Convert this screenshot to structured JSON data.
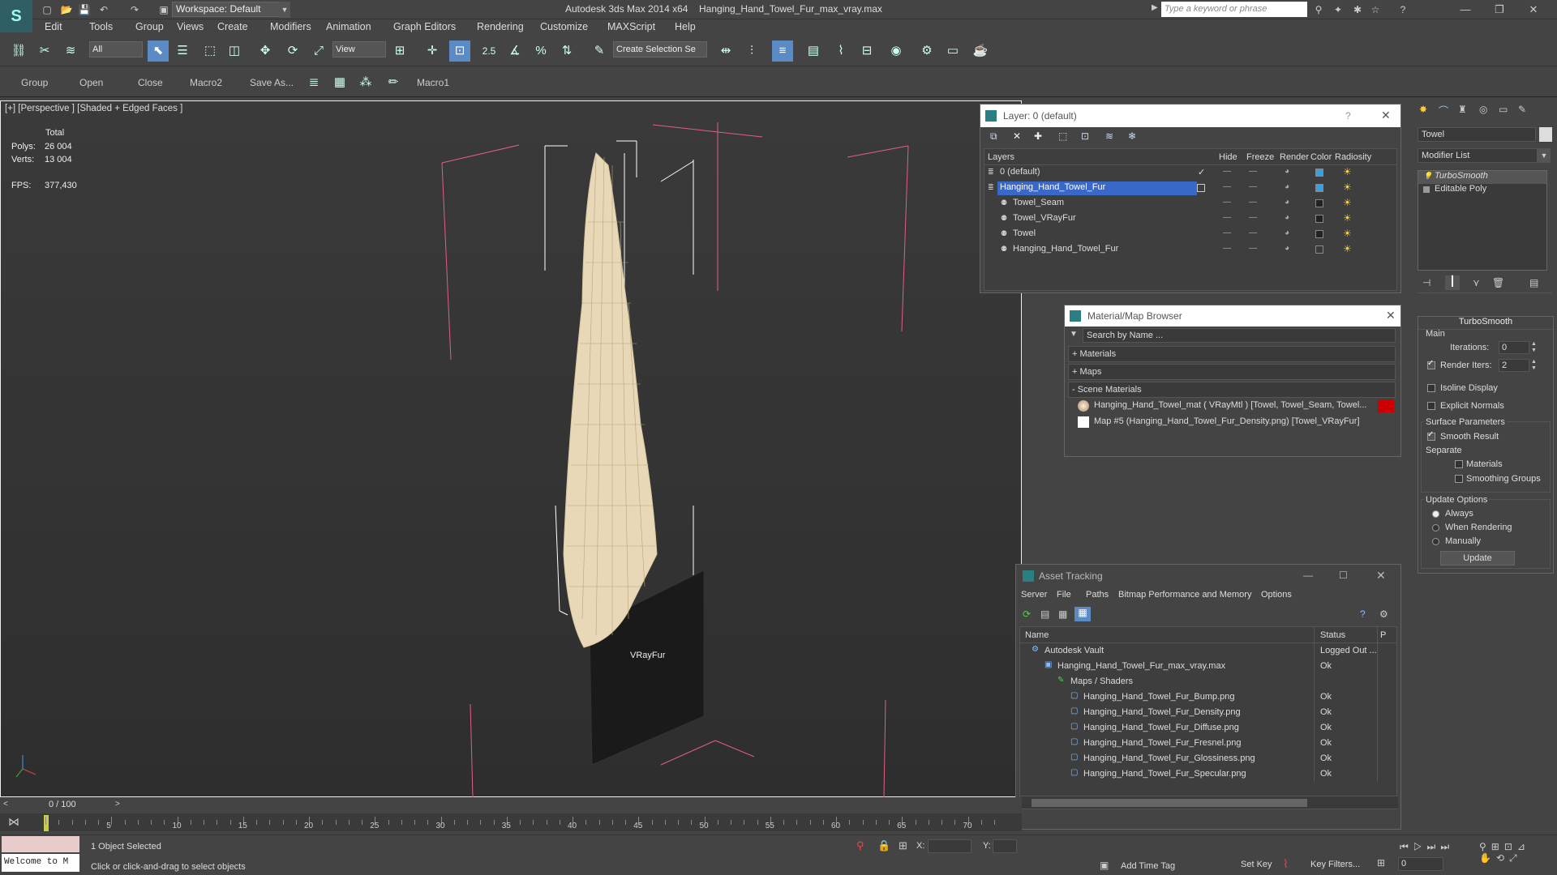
{
  "app": {
    "title": "Autodesk 3ds Max  2014 x64",
    "file": "Hanging_Hand_Towel_Fur_max_vray.max",
    "workspace": "Workspace: Default",
    "search_placeholder": "Type a keyword or phrase"
  },
  "menu": [
    "Edit",
    "Tools",
    "Group",
    "Views",
    "Create",
    "Modifiers",
    "Animation",
    "Graph Editors",
    "Rendering",
    "Customize",
    "MAXScript",
    "Help"
  ],
  "toolbar": {
    "selection_filter": "All",
    "ref_coord": "View",
    "snap_value": "2.5",
    "named_selection": "Create Selection Se"
  },
  "toolbar2": [
    "Group",
    "Open",
    "Close",
    "Macro2",
    "Save As...",
    "Macro1"
  ],
  "viewport": {
    "label": "[+] [Perspective ] [Shaded + Edged Faces ]",
    "stats_header": "Total",
    "polys_label": "Polys:",
    "polys": "26 004",
    "verts_label": "Verts:",
    "verts": "13 004",
    "fps_label": "FPS:",
    "fps": "377,430",
    "object_label": "VRayFur"
  },
  "layer_panel": {
    "title": "Layer: 0 (default)",
    "help": "?",
    "columns": [
      "Layers",
      "Hide",
      "Freeze",
      "Render",
      "Color",
      "Radiosity"
    ],
    "rows": [
      {
        "name": "0 (default)",
        "level": 0,
        "color": "#3aa0e0"
      },
      {
        "name": "Hanging_Hand_Towel_Fur",
        "level": 0,
        "color": "#3aa0e0"
      },
      {
        "name": "Towel_Seam",
        "level": 1,
        "color": "#222222"
      },
      {
        "name": "Towel_VRayFur",
        "level": 1,
        "color": "#222222"
      },
      {
        "name": "Towel",
        "level": 1,
        "color": "#222222"
      },
      {
        "name": "Hanging_Hand_Towel_Fur",
        "level": 1,
        "color": "#3a3a3a"
      }
    ]
  },
  "material_browser": {
    "title": "Material/Map Browser",
    "search_placeholder": "Search by Name ...",
    "sections": [
      "+ Materials",
      "+ Maps",
      "- Scene Materials"
    ],
    "items": [
      "Hanging_Hand_Towel_mat  ( VRayMtl )  [Towel, Towel_Seam, Towel...",
      "Map #5 (Hanging_Hand_Towel_Fur_Density.png) [Towel_VRayFur]"
    ]
  },
  "asset_tracking": {
    "title": "Asset Tracking",
    "menu": [
      "Server",
      "File",
      "Paths",
      "Bitmap Performance and Memory",
      "Options"
    ],
    "columns": [
      "Name",
      "Status",
      "P"
    ],
    "rows": [
      {
        "name": "Autodesk Vault",
        "status": "Logged Out ...",
        "level": 0
      },
      {
        "name": "Hanging_Hand_Towel_Fur_max_vray.max",
        "status": "Ok",
        "level": 1
      },
      {
        "name": "Maps / Shaders",
        "status": "",
        "level": 2
      },
      {
        "name": "Hanging_Hand_Towel_Fur_Bump.png",
        "status": "Ok",
        "level": 3
      },
      {
        "name": "Hanging_Hand_Towel_Fur_Density.png",
        "status": "Ok",
        "level": 3
      },
      {
        "name": "Hanging_Hand_Towel_Fur_Diffuse.png",
        "status": "Ok",
        "level": 3
      },
      {
        "name": "Hanging_Hand_Towel_Fur_Fresnel.png",
        "status": "Ok",
        "level": 3
      },
      {
        "name": "Hanging_Hand_Towel_Fur_Glossiness.png",
        "status": "Ok",
        "level": 3
      },
      {
        "name": "Hanging_Hand_Towel_Fur_Specular.png",
        "status": "Ok",
        "level": 3
      }
    ]
  },
  "command_panel": {
    "object_name": "Towel",
    "modifier_list": "Modifier List",
    "stack": [
      "TurboSmooth",
      "Editable Poly"
    ],
    "rollout_title": "TurboSmooth",
    "main_label": "Main",
    "iterations_label": "Iterations:",
    "iterations": "0",
    "render_iters_label": "Render Iters:",
    "render_iters": "2",
    "isoline": "Isoline Display",
    "explicit": "Explicit Normals",
    "surface_params": "Surface Parameters",
    "smooth_result": "Smooth Result",
    "separate": "Separate",
    "materials": "Materials",
    "smoothing_groups": "Smoothing Groups",
    "update_options": "Update Options",
    "always": "Always",
    "when_rendering": "When Rendering",
    "manually": "Manually",
    "update_btn": "Update"
  },
  "timeline": {
    "frame": "0 / 100",
    "ticks": [
      "5",
      "10",
      "15",
      "20",
      "25",
      "30",
      "35",
      "40",
      "45",
      "50",
      "55",
      "60",
      "65",
      "70"
    ]
  },
  "status": {
    "welcome": "Welcome to M",
    "selected": "1 Object Selected",
    "prompt": "Click or click-and-drag to select objects",
    "x_label": "X:",
    "y_label": "Y:",
    "add_time_tag": "Add Time Tag",
    "set_key": "Set Key",
    "key_filters": "Key Filters...",
    "frame_field": "0"
  }
}
